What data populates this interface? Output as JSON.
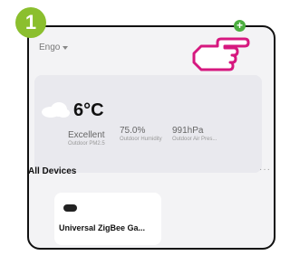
{
  "step": {
    "number": "1",
    "color": "#8bbf2e"
  },
  "header": {
    "home_name": "Engo",
    "add_icon": "plus-circle-icon",
    "accent": "#4cae3f"
  },
  "pointer": {
    "icon": "pointing-hand-icon",
    "color": "#d6187f"
  },
  "weather": {
    "icon": "cloud-icon",
    "temperature": "6°C",
    "stats": [
      {
        "value": "Excellent",
        "label": "Outdoor PM2.5"
      },
      {
        "value": "75.0%",
        "label": "Outdoor Humidity"
      },
      {
        "value": "991hPa",
        "label": "Outdoor Air Pres..."
      }
    ]
  },
  "devices": {
    "title": "All Devices",
    "more_label": "···",
    "items": [
      {
        "name": "Universal ZigBee Ga...",
        "icon": "gateway-icon"
      }
    ]
  }
}
